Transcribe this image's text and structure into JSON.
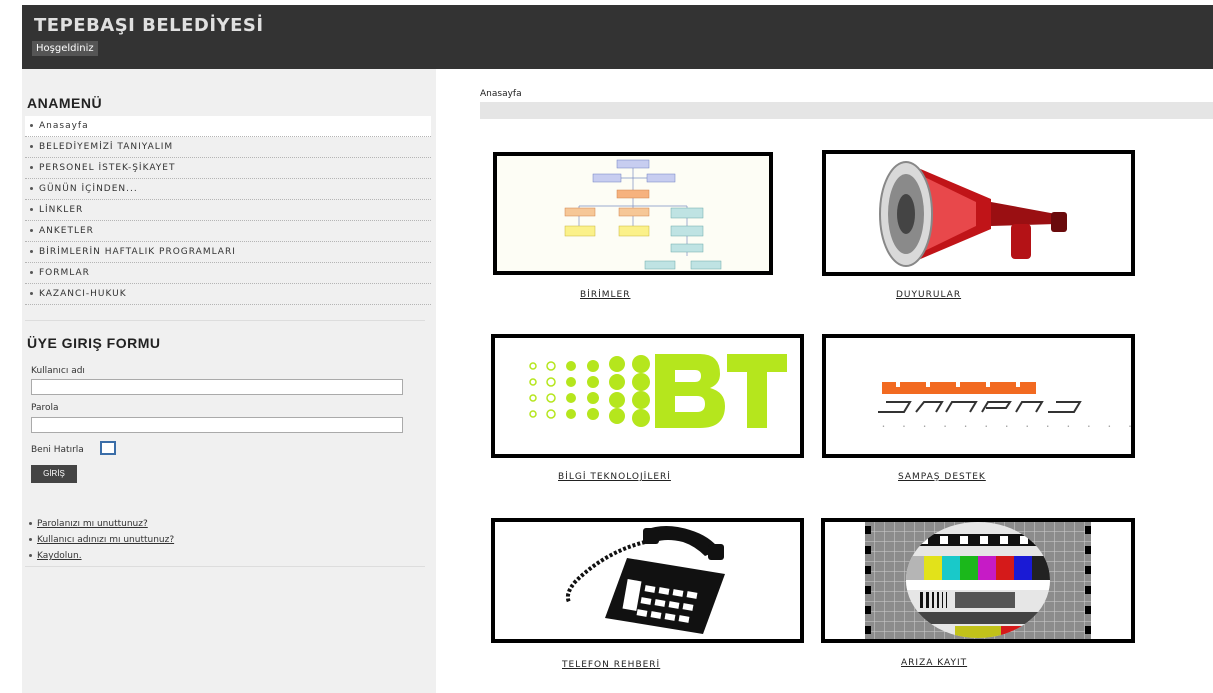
{
  "header": {
    "title": "TEPEBAŞI BELEDİYESİ",
    "welcome": "Hoşgeldiniz"
  },
  "sidebar": {
    "menu_title": "ANAMENÜ",
    "menu": [
      "Anasayfa",
      "BELEDİYEMİZİ TANIYALIM",
      "PERSONEL İSTEK-ŞİKAYET",
      "GÜNÜN İÇİNDEN...",
      "LİNKLER",
      "ANKETLER",
      "BİRİMLERİN HAFTALIK PROGRAMLARI",
      "FORMLAR",
      "KAZANCI-HUKUK"
    ],
    "login": {
      "title": "ÜYE GIRIŞ FORMU",
      "username_label": "Kullanıcı adı",
      "password_label": "Parola",
      "remember_label": "Beni Hatırla",
      "submit_label": "GİRİŞ",
      "links": [
        "Parolanızı mı unuttunuz?",
        "Kullanıcı adınızı mı unuttunuz?",
        "Kaydolun."
      ]
    }
  },
  "main": {
    "breadcrumb": "Anasayfa",
    "tiles": [
      {
        "label": "BİRİMLER",
        "icon": "org-chart-icon"
      },
      {
        "label": "DUYURULAR",
        "icon": "megaphone-icon"
      },
      {
        "label": "BİLGİ TEKNOLOJİLERİ",
        "icon": "bt-logo-icon"
      },
      {
        "label": "SAMPAŞ DESTEK",
        "icon": "sampas-logo-icon"
      },
      {
        "label": "TELEFON REHBERİ",
        "icon": "telephone-icon"
      },
      {
        "label": "ARIZA KAYIT",
        "icon": "test-pattern-icon"
      }
    ],
    "colors": {
      "bt_green": "#b5e61d",
      "sampas_orange": "#f26a21"
    }
  }
}
